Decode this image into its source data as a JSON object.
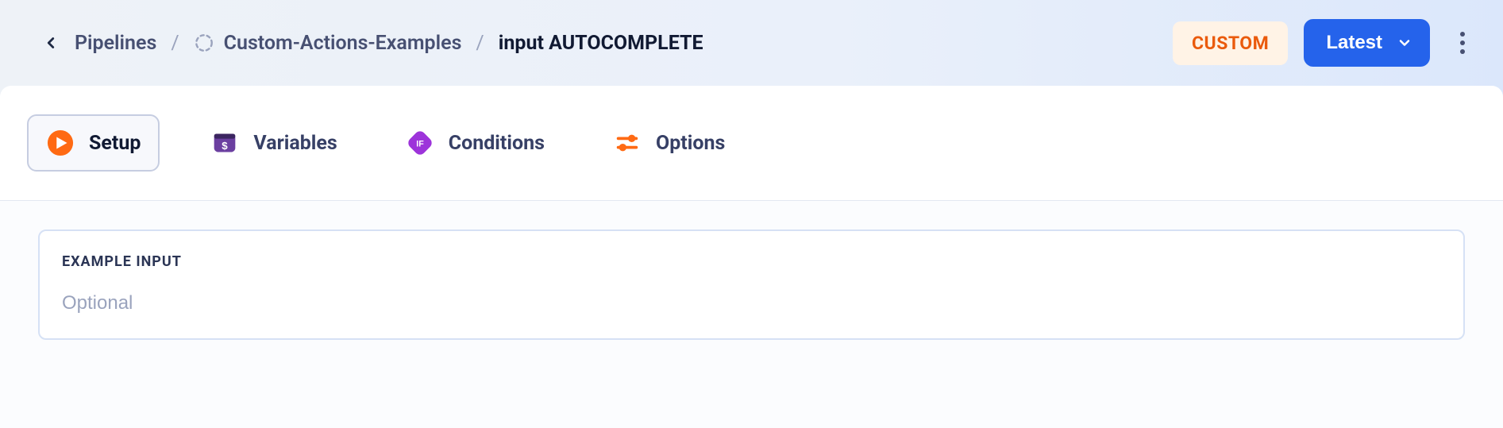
{
  "breadcrumb": {
    "root_label": "Pipelines",
    "project_label": "Custom-Actions-Examples",
    "current_label": "input AUTOCOMPLETE"
  },
  "topbar": {
    "custom_badge": "CUSTOM",
    "latest_button": "Latest"
  },
  "tabs": {
    "setup": "Setup",
    "variables": "Variables",
    "conditions": "Conditions",
    "options": "Options"
  },
  "form": {
    "example_input_label": "EXAMPLE INPUT",
    "example_input_value": "",
    "example_input_placeholder": "Optional"
  },
  "colors": {
    "accent_blue": "#2563eb",
    "accent_orange": "#ea5a0c",
    "tab_purple": "#6b3fa0",
    "play_orange": "#ff6a13"
  }
}
